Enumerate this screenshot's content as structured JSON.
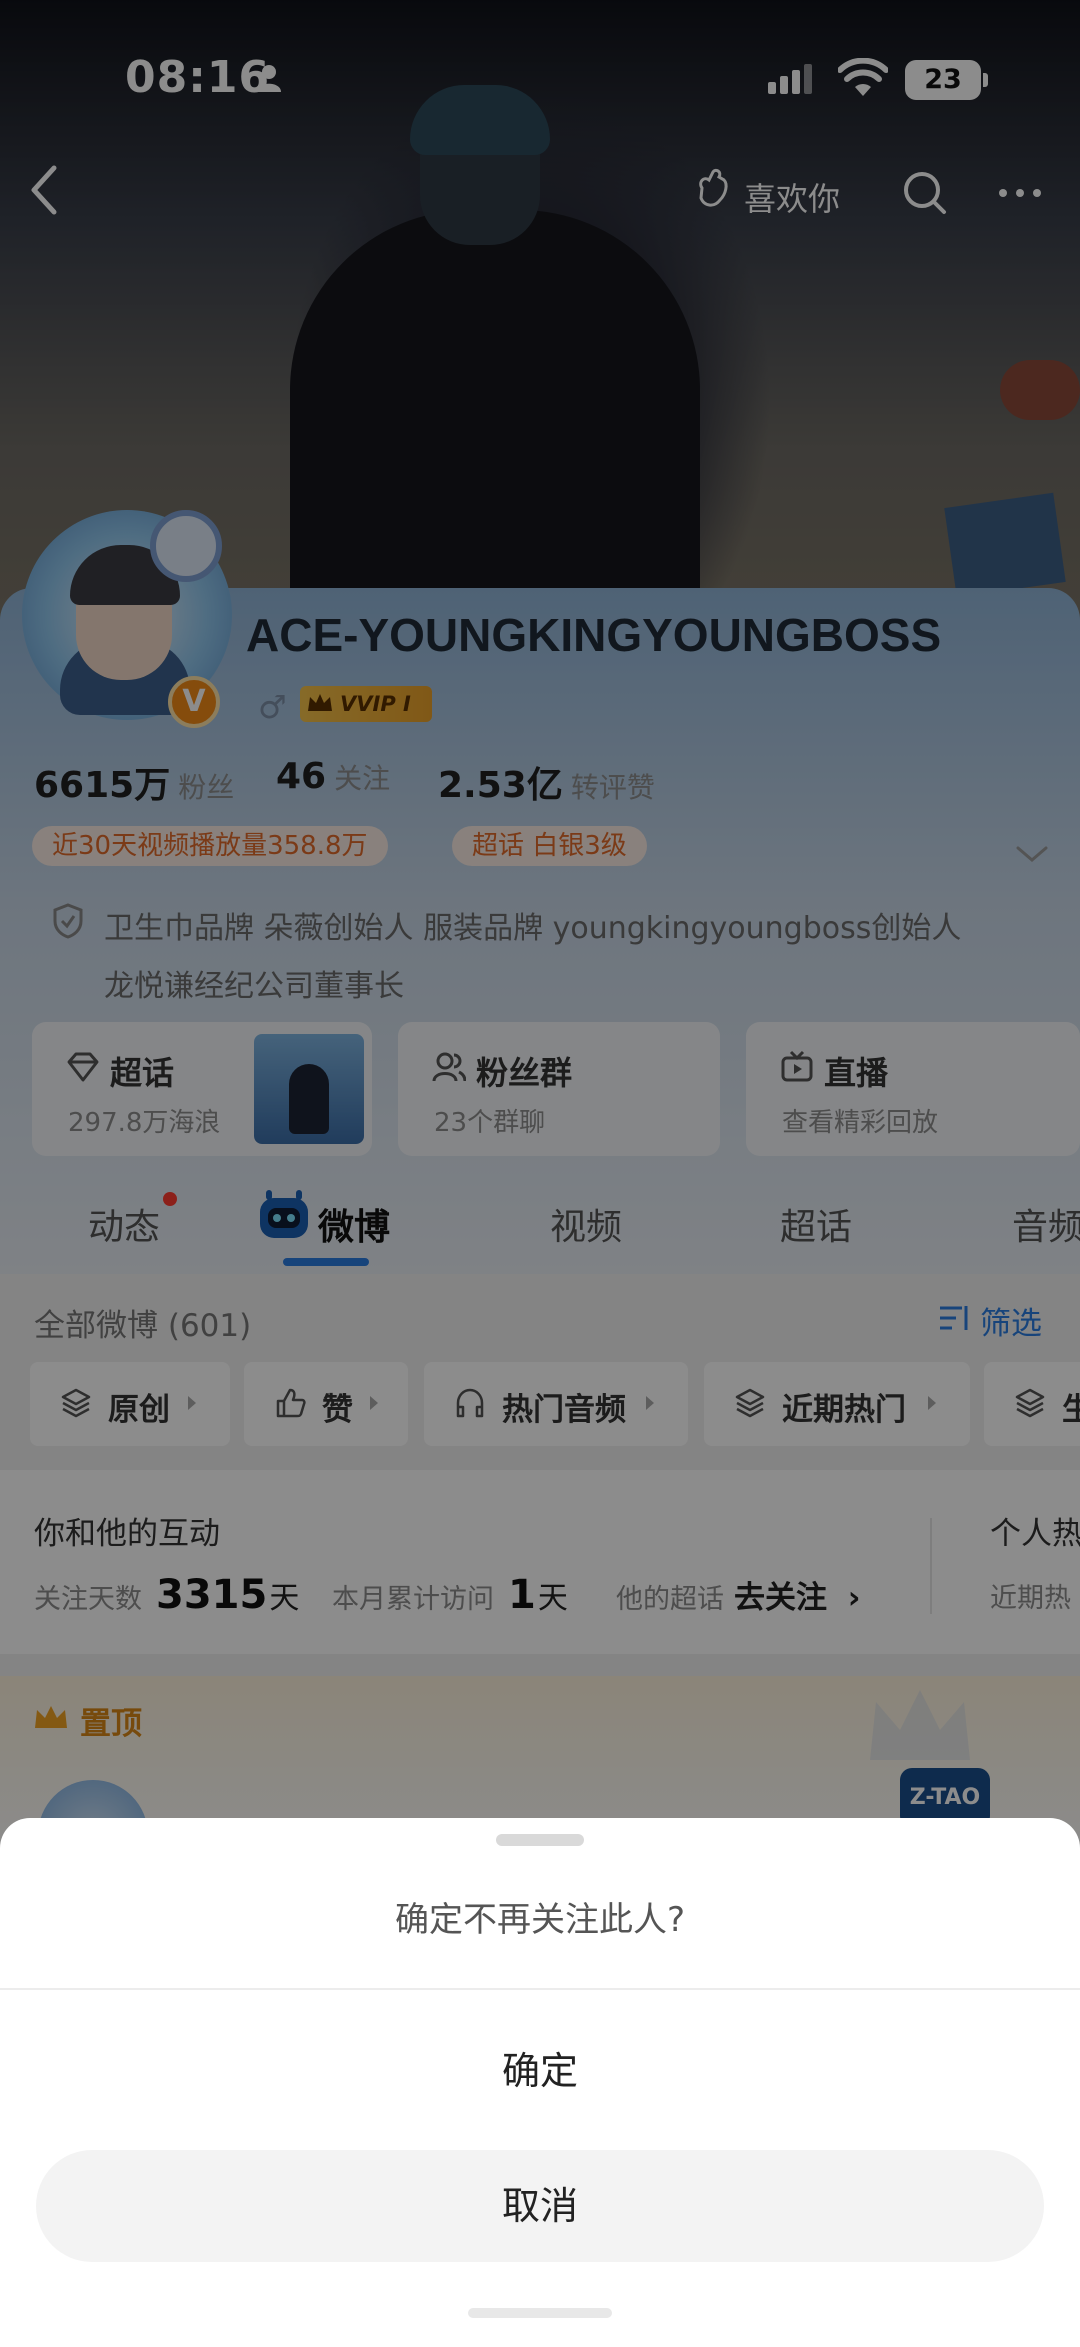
{
  "status_bar": {
    "time": "08:16",
    "battery": "23"
  },
  "nav": {
    "like_label": "喜欢你"
  },
  "profile": {
    "username": "ACE-YOUNGKINGYOUNGBOSS",
    "gender_symbol": "♂",
    "vip_label": "VVIP I",
    "verified_symbol": "V",
    "stats": [
      {
        "value": "6615万",
        "label": "粉丝"
      },
      {
        "value": "46",
        "label": "关注"
      },
      {
        "value": "2.53亿",
        "label": "转评赞"
      }
    ],
    "pills": {
      "video_plays": "近30天视频播放量358.8万",
      "super_topic_level": "超话 白银3级"
    },
    "bio_line1": "卫生巾品牌 朵薇创始人 服装品牌 youngkingyoungboss创始人",
    "bio_line2": "龙悦谦经纪公司董事长"
  },
  "feature_cards": {
    "chaohua": {
      "title": "超话",
      "sub": "297.8万海浪"
    },
    "fans_group": {
      "title": "粉丝群",
      "sub": "23个群聊"
    },
    "live": {
      "title": "直播",
      "sub": "查看精彩回放"
    }
  },
  "tabs": [
    {
      "label": "动态"
    },
    {
      "label": "微博",
      "active": true
    },
    {
      "label": "视频"
    },
    {
      "label": "超话"
    },
    {
      "label": "音频"
    }
  ],
  "feed": {
    "all_weibo": "全部微博 (601)",
    "filter_label": "筛选",
    "chips": [
      "原创",
      "赞",
      "热门音频",
      "近期热门",
      "生"
    ]
  },
  "interaction": {
    "title": "你和他的互动",
    "follow_days_label": "关注天数",
    "follow_days_value": "3315",
    "days_unit": "天",
    "visits_label": "本月累计访问",
    "visits_value": "1",
    "super_label": "他的超话",
    "super_action": "去关注",
    "right_title": "个人热",
    "right_sub": "近期热"
  },
  "pinned": {
    "label": "置顶",
    "ztao": "Z-TAO"
  },
  "sheet": {
    "question": "确定不再关注此人?",
    "confirm": "确定",
    "cancel": "取消"
  },
  "colors": {
    "accent_blue": "#2a7de1",
    "accent_orange": "#e06a2a",
    "pinned_gold": "#d98816"
  }
}
